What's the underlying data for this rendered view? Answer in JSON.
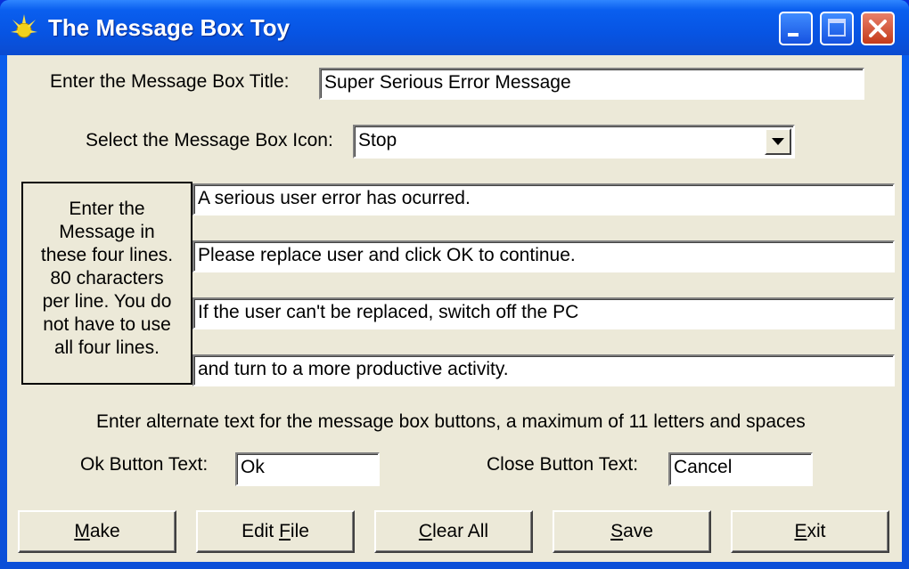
{
  "window": {
    "title": "The Message Box Toy"
  },
  "form": {
    "title_label": "Enter the Message Box Title:",
    "title_value": "Super Serious Error Message",
    "icon_label": "Select the Message Box Icon:",
    "icon_value": "Stop",
    "message_help_lines": [
      "Enter the",
      "Message in",
      "these four lines.",
      "80 characters",
      "per line.  You do",
      "not have to use",
      "all four lines."
    ],
    "message_lines": [
      "A serious user error has ocurred.",
      "Please replace user and click OK to continue.",
      "If the user can't be replaced, switch off the PC",
      "and turn to a more productive activity."
    ],
    "alt_text_label": "Enter alternate text for the message box buttons,  a maximum of 11 letters and spaces",
    "ok_label": "Ok Button Text:",
    "ok_value": "Ok",
    "close_label": "Close Button Text:",
    "close_value": "Cancel"
  },
  "buttons": {
    "make": {
      "accel": "M",
      "rest": "ake"
    },
    "edit_file": {
      "pre": "Edit ",
      "accel": "F",
      "rest": "ile"
    },
    "clear_all": {
      "accel": "C",
      "rest": "lear All"
    },
    "save": {
      "accel": "S",
      "rest": "ave"
    },
    "exit": {
      "accel": "E",
      "rest": "xit"
    }
  },
  "colors": {
    "titlebar": "#0a5fef",
    "client": "#ece9d8",
    "close_button": "#c43a1a"
  },
  "icons": {
    "app": "fireworks-icon",
    "minimize": "minimize-icon",
    "maximize": "maximize-icon",
    "close": "close-icon",
    "dropdown": "dropdown-arrow-icon"
  }
}
